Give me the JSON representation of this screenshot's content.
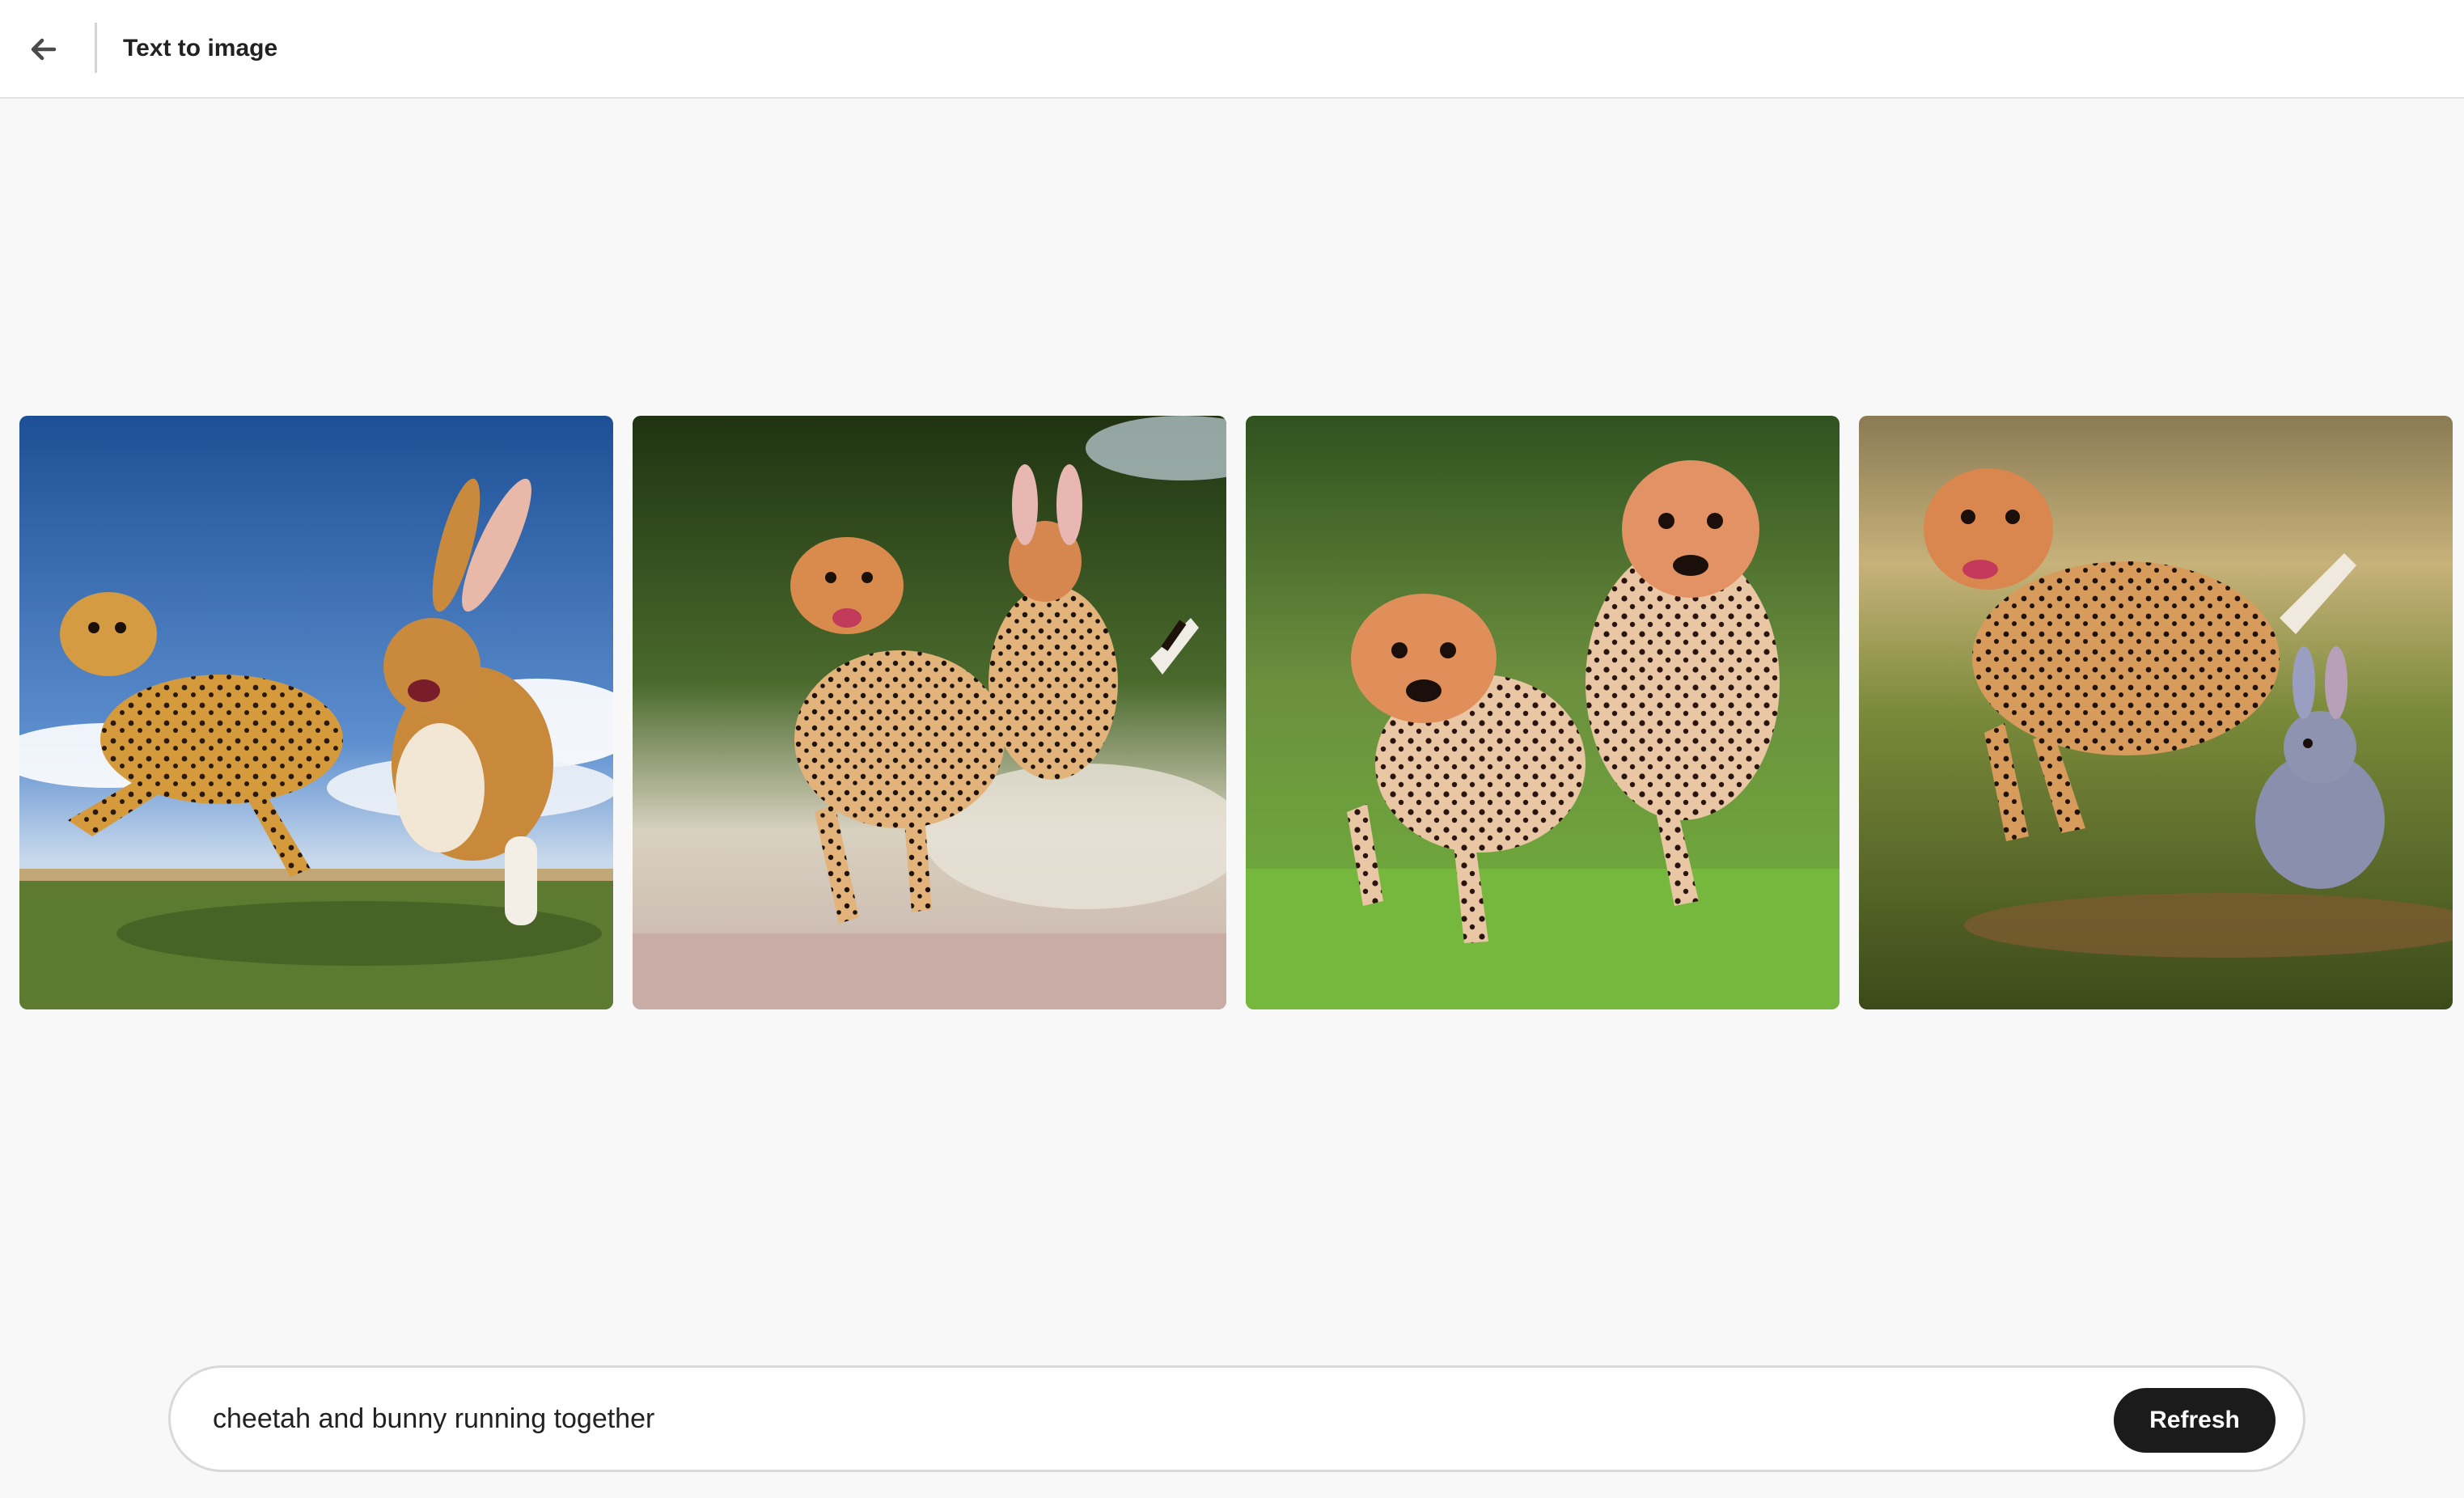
{
  "header": {
    "back_icon": "arrow-left-icon",
    "title": "Text to image"
  },
  "gallery": {
    "images": [
      {
        "scene": "cheetah and rabbit running on grass under blue sky",
        "sky": "#2f6fb8",
        "ground": "#5f7c35"
      },
      {
        "scene": "cheetah and spotted hare leaping over dirt path",
        "sky": "#3b5a2a",
        "ground": "#c8b6ad"
      },
      {
        "scene": "two cheetahs running on green lawn",
        "sky": "#3f6f2a",
        "ground": "#6fae3a"
      },
      {
        "scene": "cheetah and grey bunny running in meadow",
        "sky": "#b9a46a",
        "ground": "#5f6e2c"
      }
    ]
  },
  "prompt": {
    "value": "cheetah and bunny running together",
    "button_label": "Refresh"
  }
}
